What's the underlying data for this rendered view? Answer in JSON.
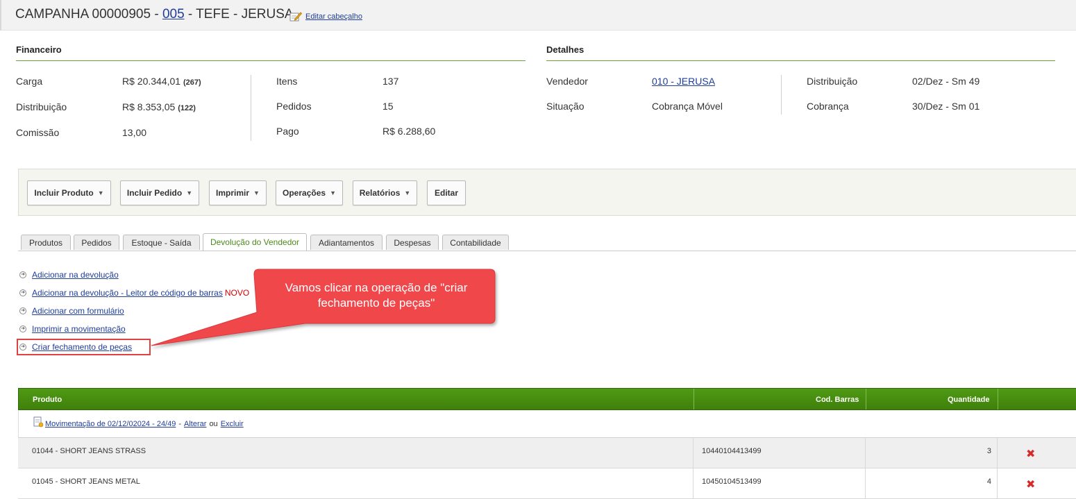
{
  "header": {
    "title_prefix": "CAMPANHA 00000905 - ",
    "title_link": "005",
    "title_suffix": " - TEFE - JERUSA",
    "edit_link": "Editar cabeçalho"
  },
  "financeiro": {
    "title": "Financeiro",
    "rows": [
      {
        "label": "Carga",
        "value": "R$ 20.344,01",
        "count": "(267)"
      },
      {
        "label": "Distribuição",
        "value": "R$ 8.353,05",
        "count": "(122)"
      },
      {
        "label": "Comissão",
        "value": "13,00",
        "count": ""
      }
    ],
    "rows2": [
      {
        "label": "Itens",
        "value": "137"
      },
      {
        "label": "Pedidos",
        "value": "15"
      },
      {
        "label": "Pago",
        "value": "R$ 6.288,60"
      }
    ]
  },
  "detalhes": {
    "title": "Detalhes",
    "vendedor_label": "Vendedor",
    "vendedor_value": "010 - JERUSA",
    "situacao_label": "Situação",
    "situacao_value": "Cobrança Móvel",
    "distribuicao_label": "Distribuição",
    "distribuicao_value": "02/Dez - Sm 49",
    "cobranca_label": "Cobrança",
    "cobranca_value": "30/Dez - Sm 01"
  },
  "toolbar": {
    "incluir_produto": "Incluir Produto",
    "incluir_pedido": "Incluir Pedido",
    "imprimir": "Imprimir",
    "operacoes": "Operações",
    "relatorios": "Relatórios",
    "editar": "Editar",
    "caret": "▼"
  },
  "tabs": [
    "Produtos",
    "Pedidos",
    "Estoque - Saída",
    "Devolução do Vendedor",
    "Adiantamentos",
    "Despesas",
    "Contabilidade"
  ],
  "actions": {
    "a1": "Adicionar na devolução",
    "a2": "Adicionar na devolução - Leitor de código de barras",
    "novo": "NOVO",
    "a3": "Adicionar com formulário",
    "a4": "Imprimir a movimentação",
    "a5": "Criar fechamento de peças"
  },
  "callout": {
    "line1": "Vamos clicar na operação de \"criar",
    "line2": "fechamento de peças\""
  },
  "table": {
    "headers": {
      "produto": "Produto",
      "cod_barras": "Cod. Barras",
      "quantidade": "Quantidade"
    },
    "group": {
      "link": "Movimentação de 02/12/02024 - 24/49",
      "sep1": "-",
      "alterar": "Alterar",
      "ou": "ou",
      "excluir": "Excluir"
    },
    "rows": [
      {
        "produto": "01044 - SHORT JEANS STRASS",
        "cod": "10440104413499",
        "qtd": "3"
      },
      {
        "produto": "01045 - SHORT JEANS METAL",
        "cod": "10450104513499",
        "qtd": "4"
      }
    ]
  },
  "icons": {
    "delete": "✖"
  },
  "colors": {
    "accent_green": "#4f9a14",
    "callout_red": "#f0464b",
    "link_blue": "#1f3d99"
  }
}
